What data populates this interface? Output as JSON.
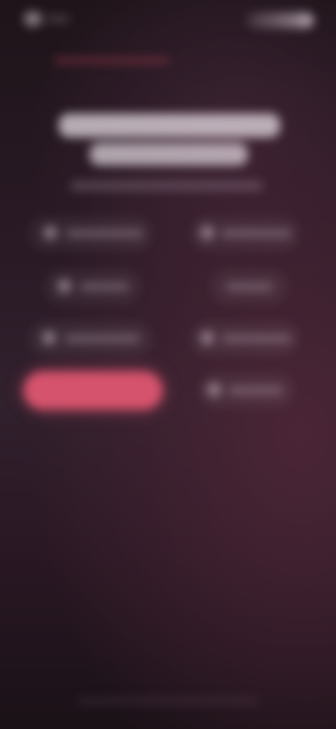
{
  "status_bar": {
    "left_icon": "app-icon",
    "right_icon": "status-indicators-icon"
  },
  "header": {
    "accent_color": "#c8465a"
  },
  "title": {
    "line1": "",
    "line2": ""
  },
  "subtitle": "",
  "options": [
    {
      "label": "",
      "icon": "option-icon",
      "selected": false
    },
    {
      "label": "",
      "icon": "option-icon",
      "selected": false
    },
    {
      "label": "",
      "icon": "option-icon",
      "selected": false
    },
    {
      "label": "",
      "icon": "",
      "selected": false
    },
    {
      "label": "",
      "icon": "option-icon",
      "selected": false
    },
    {
      "label": "",
      "icon": "option-icon",
      "selected": false
    },
    {
      "label": "",
      "icon": "",
      "selected": true
    },
    {
      "label": "",
      "icon": "option-icon",
      "selected": false
    }
  ],
  "colors": {
    "background_top": "#1e1419",
    "background_mid": "#31202d",
    "background_glow": "#4a2535",
    "selected_option": "#d6536d",
    "text": "#eee4ec"
  },
  "bottom_hint": ""
}
